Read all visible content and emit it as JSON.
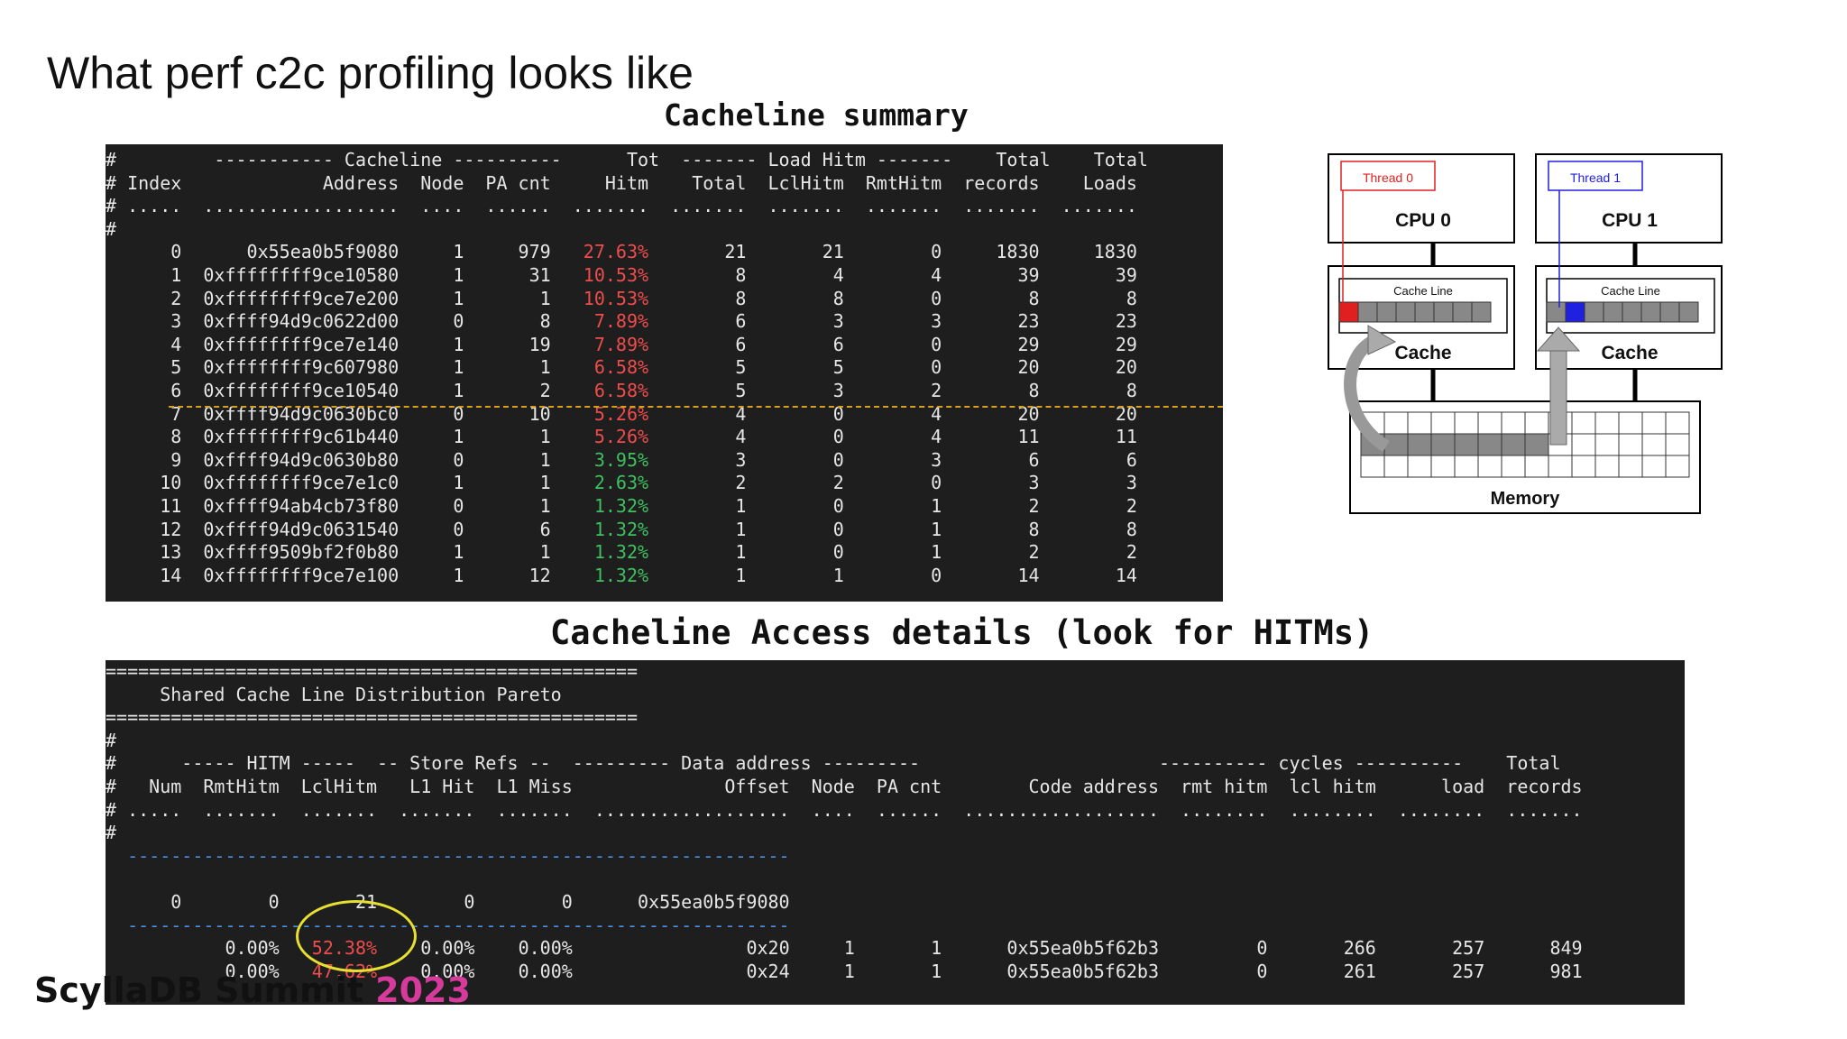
{
  "title": "What perf c2c profiling looks like",
  "section1_label": "Cacheline summary",
  "section2_label": "Cacheline Access details (look for HITMs)",
  "summary": {
    "header_lines": [
      "#         ----------- Cacheline ----------      Tot  ------- Load Hitm -------    Total    Total",
      "# Index             Address  Node  PA cnt     Hitm    Total  LclHitm  RmtHitm  records    Loads",
      "# .....  ..................  ....  ......  .......  .......  .......  .......  .......  .......",
      "#"
    ],
    "rows": [
      {
        "idx": "0",
        "addr": "0x55ea0b5f9080",
        "node": "1",
        "pa": "979",
        "hitm": "27.63%",
        "color": "red",
        "total": "21",
        "lcl": "21",
        "rmt": "0",
        "records": "1830",
        "loads": "1830"
      },
      {
        "idx": "1",
        "addr": "0xffffffff9ce10580",
        "node": "1",
        "pa": "31",
        "hitm": "10.53%",
        "color": "red",
        "total": "8",
        "lcl": "4",
        "rmt": "4",
        "records": "39",
        "loads": "39"
      },
      {
        "idx": "2",
        "addr": "0xffffffff9ce7e200",
        "node": "1",
        "pa": "1",
        "hitm": "10.53%",
        "color": "red",
        "total": "8",
        "lcl": "8",
        "rmt": "0",
        "records": "8",
        "loads": "8"
      },
      {
        "idx": "3",
        "addr": "0xffff94d9c0622d00",
        "node": "0",
        "pa": "8",
        "hitm": "7.89%",
        "color": "red",
        "total": "6",
        "lcl": "3",
        "rmt": "3",
        "records": "23",
        "loads": "23"
      },
      {
        "idx": "4",
        "addr": "0xffffffff9ce7e140",
        "node": "1",
        "pa": "19",
        "hitm": "7.89%",
        "color": "red",
        "total": "6",
        "lcl": "6",
        "rmt": "0",
        "records": "29",
        "loads": "29"
      },
      {
        "idx": "5",
        "addr": "0xffffffff9c607980",
        "node": "1",
        "pa": "1",
        "hitm": "6.58%",
        "color": "red",
        "total": "5",
        "lcl": "5",
        "rmt": "0",
        "records": "20",
        "loads": "20"
      },
      {
        "idx": "6",
        "addr": "0xffffffff9ce10540",
        "node": "1",
        "pa": "2",
        "hitm": "6.58%",
        "color": "red",
        "total": "5",
        "lcl": "3",
        "rmt": "2",
        "records": "8",
        "loads": "8"
      },
      {
        "idx": "7",
        "addr": "0xffff94d9c0630bc0",
        "node": "0",
        "pa": "10",
        "hitm": "5.26%",
        "color": "red",
        "total": "4",
        "lcl": "0",
        "rmt": "4",
        "records": "20",
        "loads": "20"
      },
      {
        "idx": "8",
        "addr": "0xffffffff9c61b440",
        "node": "1",
        "pa": "1",
        "hitm": "5.26%",
        "color": "red",
        "total": "4",
        "lcl": "0",
        "rmt": "4",
        "records": "11",
        "loads": "11"
      },
      {
        "idx": "9",
        "addr": "0xffff94d9c0630b80",
        "node": "0",
        "pa": "1",
        "hitm": "3.95%",
        "color": "green",
        "total": "3",
        "lcl": "0",
        "rmt": "3",
        "records": "6",
        "loads": "6"
      },
      {
        "idx": "10",
        "addr": "0xffffffff9ce7e1c0",
        "node": "1",
        "pa": "1",
        "hitm": "2.63%",
        "color": "green",
        "total": "2",
        "lcl": "2",
        "rmt": "0",
        "records": "3",
        "loads": "3"
      },
      {
        "idx": "11",
        "addr": "0xffff94ab4cb73f80",
        "node": "0",
        "pa": "1",
        "hitm": "1.32%",
        "color": "green",
        "total": "1",
        "lcl": "0",
        "rmt": "1",
        "records": "2",
        "loads": "2"
      },
      {
        "idx": "12",
        "addr": "0xffff94d9c0631540",
        "node": "0",
        "pa": "6",
        "hitm": "1.32%",
        "color": "green",
        "total": "1",
        "lcl": "0",
        "rmt": "1",
        "records": "8",
        "loads": "8"
      },
      {
        "idx": "13",
        "addr": "0xffff9509bf2f0b80",
        "node": "1",
        "pa": "1",
        "hitm": "1.32%",
        "color": "green",
        "total": "1",
        "lcl": "0",
        "rmt": "1",
        "records": "2",
        "loads": "2"
      },
      {
        "idx": "14",
        "addr": "0xffffffff9ce7e100",
        "node": "1",
        "pa": "12",
        "hitm": "1.32%",
        "color": "green",
        "total": "1",
        "lcl": "1",
        "rmt": "0",
        "records": "14",
        "loads": "14"
      }
    ]
  },
  "details": {
    "banner_rule": "=================================================",
    "banner_title": "     Shared Cache Line Distribution Pareto",
    "header_lines": [
      "#",
      "#      ----- HITM -----  -- Store Refs --  --------- Data address ---------                      ---------- cycles ----------    Total",
      "#   Num  RmtHitm  LclHitm   L1 Hit  L1 Miss              Offset  Node  PA cnt        Code address  rmt hitm  lcl hitm      load  records",
      "# .....  .......  .......  .......  .......  ..................  ....  ......  ..................  ........  ........  ........  .......",
      "#"
    ],
    "dash_rule": "  -------------------------------------------------------------",
    "summary_row": "      0        0       21        0        0      0x55ea0b5f9080",
    "rows": [
      {
        "rmt": "0.00%",
        "lcl": "52.38%",
        "l1hit": "0.00%",
        "l1miss": "0.00%",
        "offset": "0x20",
        "node": "1",
        "pa": "1",
        "code": "0x55ea0b5f62b3",
        "rmthitm": "0",
        "lclhitm": "266",
        "load": "257",
        "records": "849"
      },
      {
        "rmt": "0.00%",
        "lcl": "47.62%",
        "l1hit": "0.00%",
        "l1miss": "0.00%",
        "offset": "0x24",
        "node": "1",
        "pa": "1",
        "code": "0x55ea0b5f62b3",
        "rmthitm": "0",
        "lclhitm": "261",
        "load": "257",
        "records": "981"
      }
    ]
  },
  "diagram": {
    "thread0": "Thread 0",
    "thread1": "Thread 1",
    "cpu0": "CPU 0",
    "cpu1": "CPU 1",
    "cache_line": "Cache Line",
    "cache": "Cache",
    "memory": "Memory",
    "colors": {
      "thread0": "#e02020",
      "thread1": "#2020e0",
      "cell": "#888888"
    }
  },
  "brand": {
    "name": "ScyllaDB Summit ",
    "year": "2023"
  }
}
